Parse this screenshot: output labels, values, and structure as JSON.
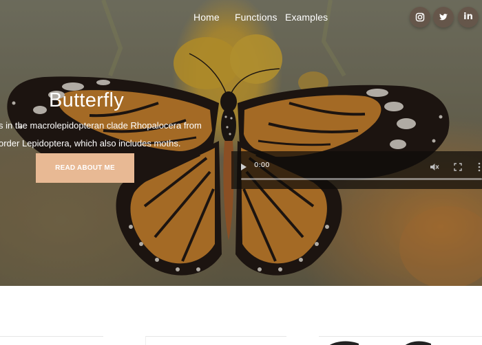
{
  "nav": {
    "links": [
      {
        "label": "Home"
      },
      {
        "label": "Functions"
      },
      {
        "label": "Examples"
      }
    ],
    "social": [
      {
        "icon": "instagram-icon"
      },
      {
        "icon": "twitter-icon"
      },
      {
        "icon": "linkedin-icon",
        "glyph": "in"
      }
    ]
  },
  "hero": {
    "title": "Butterfly",
    "description_lines": [
      "s in the macrolepidopteran clade Rhopalocera from",
      "order Lepidoptera, which also includes moths."
    ],
    "button_label": "READ ABOUT ME"
  },
  "video": {
    "current_time": "0:00",
    "progress": 0
  },
  "colors": {
    "button_bg": "#e8b994",
    "text": "#ffffff",
    "social_bg": "#645046"
  }
}
